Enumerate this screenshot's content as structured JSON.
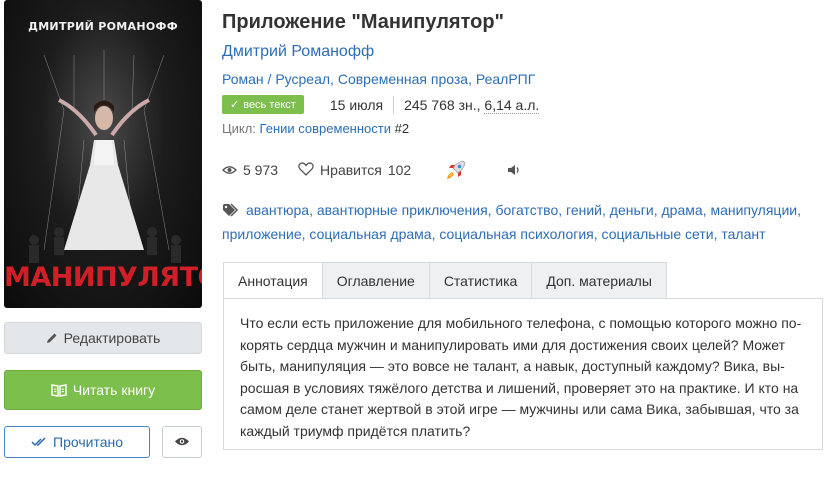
{
  "cover": {
    "author": "ДМИТРИЙ РОМАНОФФ",
    "title": "МАНИПУЛЯТОР"
  },
  "buttons": {
    "edit": "Редактировать",
    "read": "Читать книгу",
    "done": "Прочитано"
  },
  "book": {
    "title": "Приложение \"Манипулятор\"",
    "author": "Дмитрий Романофф",
    "genres": [
      "Роман",
      "Русреал",
      "Современная проза",
      "РеалРПГ"
    ],
    "badge": "весь текст",
    "date": "15 июля",
    "size_chars": "245 768 зн.,",
    "size_al": "6,14 а.л.",
    "cycle_label": "Цикл:",
    "cycle_name": "Гении современности",
    "cycle_num": "#2"
  },
  "stats": {
    "views": "5 973",
    "likes_label": "Нравится",
    "likes": "102"
  },
  "tags": [
    "авантюра",
    "авантюрные приключения",
    "богатство",
    "гений",
    "деньги",
    "драма",
    "манипуляции",
    "приложение",
    "социальная драма",
    "социальная психология",
    "социальные сети",
    "талант"
  ],
  "tabs": [
    "Аннотация",
    "Оглавление",
    "Статистика",
    "Доп. материалы"
  ],
  "annotation": "Что если есть приложение для мобильного телефона, с помощью которого можно по-корять сердца мужчин и манипулировать ими для достижения своих целей? Может быть, манипуляция — это вовсе не талант, а навык, доступный каждому? Вика, вы-росшая в условиях тяжёлого детства и лишений, проверяет это на практике. И кто на самом деле станет жертвой в этой игре — мужчины или сама Вика, забывшая, что за каждый триумф придётся платить?",
  "colors": {
    "link": "#2d6db4",
    "green": "#7cbf4d",
    "cover_title": "#d11f27"
  }
}
